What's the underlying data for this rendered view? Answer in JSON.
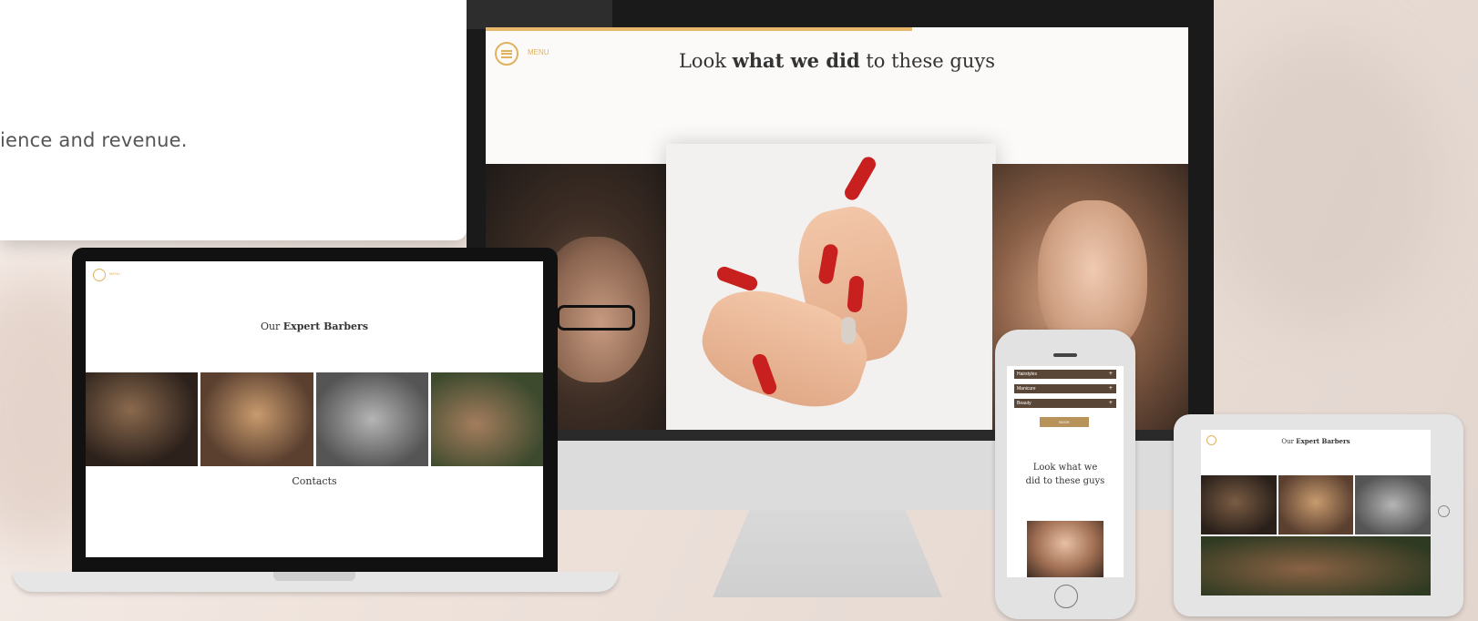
{
  "card": {
    "text": "ience and revenue."
  },
  "monitor": {
    "menu_label": "MENU",
    "title_pre": "Look ",
    "title_bold": "what we did",
    "title_post": " to these guys"
  },
  "laptop": {
    "menu_label": "MENU",
    "title_pre": "Our ",
    "title_bold": "Expert Barbers",
    "contacts_title": "Contacts"
  },
  "phone": {
    "rows": [
      "Hairstyles",
      "Manicure",
      "Beauty"
    ],
    "button": "BOOK",
    "title": "Look what we did to these guys"
  },
  "tablet": {
    "title_pre": "Our ",
    "title_bold": "Expert Barbers"
  },
  "colors": {
    "accent": "#e0b25f",
    "brown": "#5a4636",
    "red_nail": "#c8201e"
  }
}
